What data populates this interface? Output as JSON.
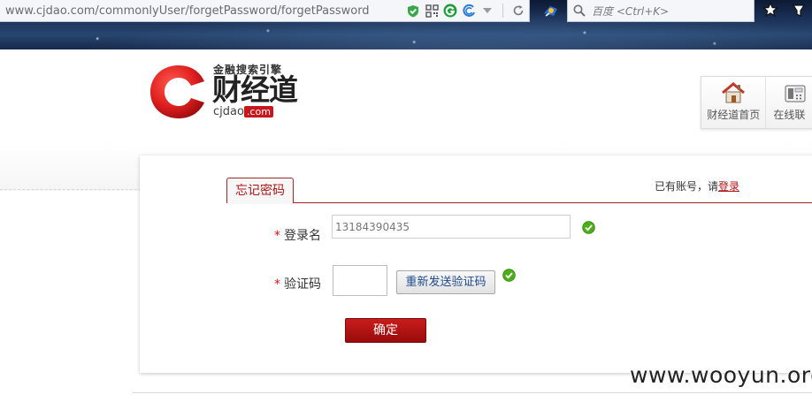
{
  "browser": {
    "url": "www.cjdao.com/commonlyUser/forgetPassword/forgetPassword",
    "search_placeholder": "百度 <Ctrl+K>"
  },
  "header": {
    "logo": {
      "tagline": "金融搜索引擎",
      "name": "财经道",
      "domain_prefix": "cjdao",
      "domain_suffix": ".com"
    },
    "nav": [
      {
        "label": "财经道首页",
        "icon": "house-icon"
      },
      {
        "label": "在线联",
        "icon": "phone-icon"
      }
    ]
  },
  "form": {
    "tab_label": "忘记密码",
    "login_hint": "已有账号，请",
    "login_link": "登录",
    "required_mark": "*",
    "username_label": "登录名",
    "username_value": "13184390435",
    "code_label": "验证码",
    "code_value": "",
    "resend_button": "重新发送验证码",
    "submit_button": "确定"
  },
  "watermark": "www.wooyun.org",
  "colors": {
    "brand_red": "#b01515",
    "button_red": "#c81c1c",
    "valid_green": "#4caf1a"
  }
}
